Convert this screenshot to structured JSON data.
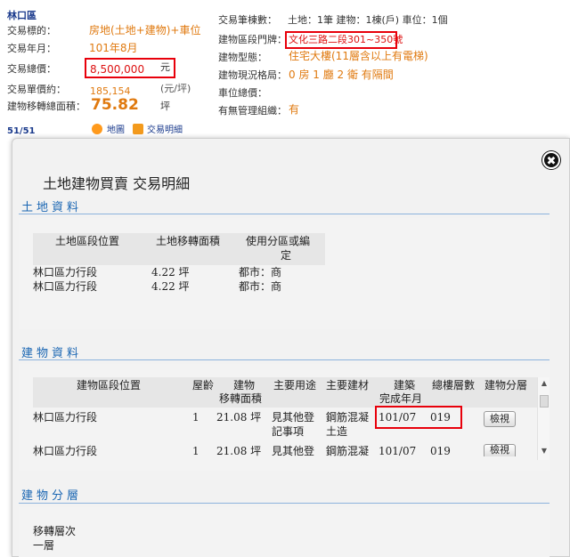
{
  "listing": {
    "district": "林口區",
    "left_labels": [
      "交易標的：",
      "交易年月：",
      "交易總價：",
      "交易單價約：",
      "建物移轉總面積："
    ],
    "target_value": "房地(土地+建物)+車位",
    "date_value": "101年8月",
    "price_value": "8,500,000",
    "price_unit": "元",
    "unit_price_value": "185,154",
    "unit_price_unit": "(元/坪)",
    "area_value": "75.82",
    "area_unit": "坪",
    "page_indicator": "51/51",
    "map_link": "地圖",
    "detail_link": "交易明細",
    "right_labels": [
      "交易筆棟數：",
      "建物區段門牌：",
      "建物型態：",
      "建物現況格局：",
      "車位總價：",
      "有無管理組織："
    ],
    "counts_value": "土地：1筆 建物：1棟(戶) 車位：1個",
    "address_value": "文化三路二段301~350號",
    "building_type_value": "住宅大樓(11層含以上有電梯)",
    "layout_value": "0 房 1 廳 2 衛 有隔間",
    "management_value": "有"
  },
  "modal": {
    "title": "土地建物買賣 交易明細",
    "close_icon": "✖",
    "land": {
      "heading": "土地資料",
      "headers": [
        "土地區段位置",
        "土地移轉面積",
        "使用分區或編",
        "定"
      ],
      "rows": [
        {
          "location": "林口區力行段",
          "area": "4.22 坪",
          "zone": "都市：商"
        },
        {
          "location": "林口區力行段",
          "area": "4.22 坪",
          "zone": "都市：商"
        }
      ]
    },
    "building": {
      "heading": "建物資料",
      "headers": [
        "建物區段位置",
        "屋齡",
        "建物",
        "移轉面積",
        "主要用途",
        "主要建材",
        "建築",
        "完成年月",
        "總樓層數",
        "建物分層"
      ],
      "rows": [
        {
          "location": "林口區力行段",
          "age": "1",
          "area": "21.08 坪",
          "use1": "見其他登",
          "use2": "記事項",
          "mat1": "鋼筋混凝",
          "mat2": "土造",
          "date": "101/07",
          "floors": "019",
          "btn": "檢視"
        },
        {
          "location": "林口區力行段",
          "age": "1",
          "area": "21.08 坪",
          "use1": "見其他登",
          "mat1": "鋼筋混凝",
          "date": "101/07",
          "floors": "019",
          "btn": "檢視"
        }
      ]
    },
    "floors_section": {
      "heading": "建物分層",
      "header": "移轉層次",
      "value": "一層"
    }
  },
  "colors": {
    "accent_orange": "#e07a10",
    "highlight_red": "#e8000b",
    "section_blue": "#1a66b3",
    "link_navy": "#1a3a8c"
  }
}
